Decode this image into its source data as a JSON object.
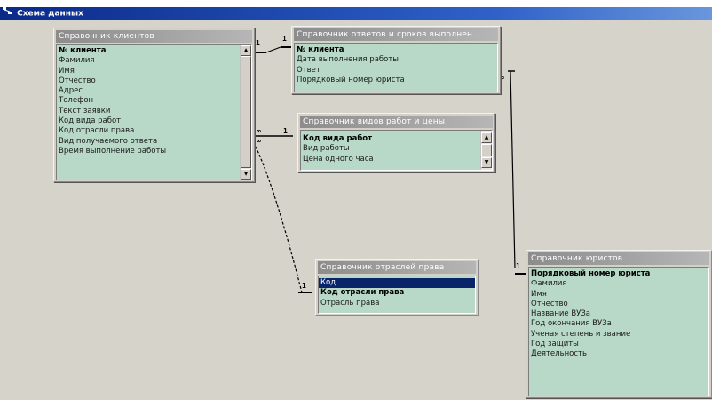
{
  "window": {
    "title": "Схема данных",
    "icon": "relationships-window-icon"
  },
  "tables": {
    "clients": {
      "title": "Справочник клиентов",
      "fields": [
        {
          "label": "№ клиента",
          "key": true
        },
        {
          "label": "Фамилия"
        },
        {
          "label": "Имя"
        },
        {
          "label": "Отчество"
        },
        {
          "label": "Адрес"
        },
        {
          "label": "Телефон"
        },
        {
          "label": "Текст заявки"
        },
        {
          "label": "Код вида работ"
        },
        {
          "label": "Код отрасли права"
        },
        {
          "label": "Вид получаемого ответа"
        },
        {
          "label": "Время выполнение работы"
        }
      ]
    },
    "answers": {
      "title": "Справочник ответов и сроков выполнен...",
      "fields": [
        {
          "label": "№ клиента",
          "key": true
        },
        {
          "label": "Дата выполнения работы"
        },
        {
          "label": "Ответ"
        },
        {
          "label": "Порядковый номер юриста"
        }
      ]
    },
    "work_types": {
      "title": "Справочник видов работ и цены",
      "fields": [
        {
          "label": "Код вида работ",
          "key": true
        },
        {
          "label": "Вид работы"
        },
        {
          "label": "Цена одного часа"
        }
      ]
    },
    "law_branches": {
      "title": "Справочник отраслей права",
      "fields": [
        {
          "label": "Код",
          "selected": true
        },
        {
          "label": "Код отрасли права",
          "key": true
        },
        {
          "label": "Отрасль права"
        }
      ]
    },
    "lawyers": {
      "title": "Справочник юристов",
      "fields": [
        {
          "label": "Порядковый номер юриста",
          "key": true
        },
        {
          "label": "Фамилия"
        },
        {
          "label": "Имя"
        },
        {
          "label": "Отчество"
        },
        {
          "label": "Название ВУЗа"
        },
        {
          "label": "Год окончания ВУЗа"
        },
        {
          "label": "Ученая степень и звание"
        },
        {
          "label": "Год защиты"
        },
        {
          "label": "Деятельность"
        }
      ]
    }
  },
  "relationships": [
    {
      "one": "1",
      "many": "1",
      "from": "clients",
      "to": "answers"
    },
    {
      "one": "1",
      "many": "∞",
      "from": "work_types",
      "to": "clients"
    },
    {
      "one": "1",
      "many": "∞",
      "from": "law_branches",
      "to": "clients"
    },
    {
      "one": "1",
      "many": "∞",
      "from": "lawyers",
      "to": "answers"
    }
  ],
  "colors": {
    "canvas": "#d6d3cb",
    "field_list": "#b8d8c8",
    "selection": "#0a246a",
    "title_bar": "#0a2a8a"
  }
}
